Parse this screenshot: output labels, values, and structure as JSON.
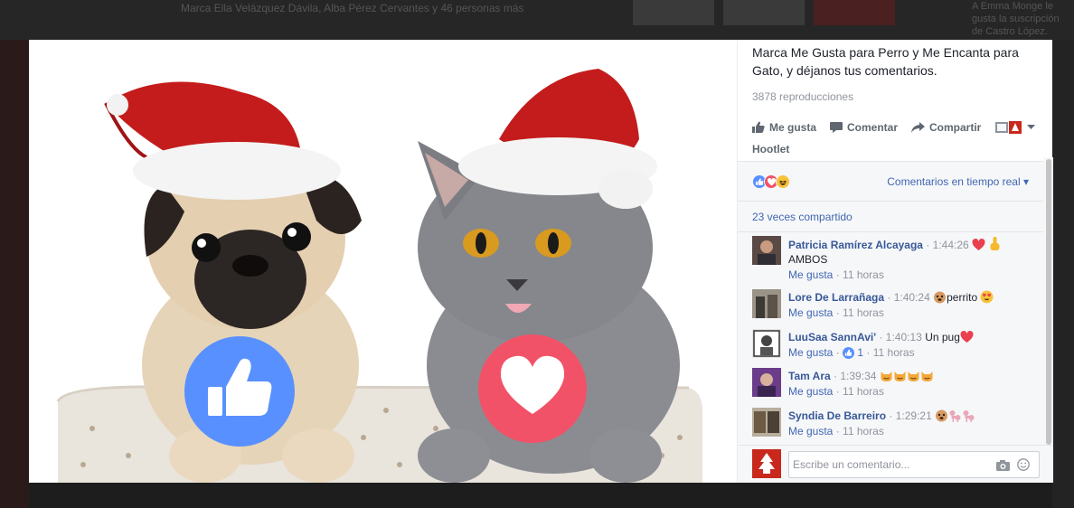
{
  "background": {
    "tag_line": "Marca Ella Velázquez Dávila, Alba Pérez Cervantes y 46 personas más",
    "side_text": "A Emma Monge le gusta la suscripción de Castro López."
  },
  "post": {
    "caption": "Marca Me Gusta para Perro y Me Encanta para Gato, y déjanos tus comentarios.",
    "views": "3878 reproducciones",
    "actions": {
      "like": "Me gusta",
      "comment": "Comentar",
      "share": "Compartir",
      "hootlet": "Hootlet"
    },
    "reaction_icons": [
      "like-icon",
      "love-icon",
      "haha-icon"
    ],
    "sort_label": "Comentarios en tiempo real",
    "shares": "23 veces compartido"
  },
  "comments": [
    {
      "name": "Patricia Ramírez Alcayaga",
      "time": "1:44:26",
      "text": "",
      "text2": "AMBOS",
      "like_label": "Me gusta",
      "age": "11 horas",
      "emoji": [
        "heart-emoji",
        "point-up-emoji"
      ]
    },
    {
      "name": "Lore De Larrañaga",
      "time": "1:40:24",
      "text": "perrito",
      "like_label": "Me gusta",
      "age": "11 horas",
      "emoji_before": [
        "dog-emoji"
      ],
      "emoji": [
        "heart-eyes-emoji"
      ]
    },
    {
      "name": "LuuSaa SannAvi'",
      "time": "1:40:13",
      "text": "Un pug",
      "like_label": "Me gusta",
      "age": "11 horas",
      "likes": "1",
      "emoji": [
        "heart-emoji"
      ]
    },
    {
      "name": "Tam Ara",
      "time": "1:39:34",
      "text": "",
      "like_label": "Me gusta",
      "age": "11 horas",
      "emoji": [
        "cat-emoji",
        "cat-emoji",
        "cat-emoji",
        "cat-emoji"
      ]
    },
    {
      "name": "Syndia De Barreiro",
      "time": "1:29:21",
      "text": "",
      "like_label": "Me gusta",
      "age": "11 horas",
      "emoji": [
        "dog-emoji",
        "poodle-emoji",
        "poodle-emoji"
      ]
    }
  ],
  "composer": {
    "placeholder": "Escribe un comentario..."
  },
  "colors": {
    "link": "#4267b2",
    "name": "#385898",
    "like_blue": "#5890ff",
    "love_red": "#f25268"
  }
}
